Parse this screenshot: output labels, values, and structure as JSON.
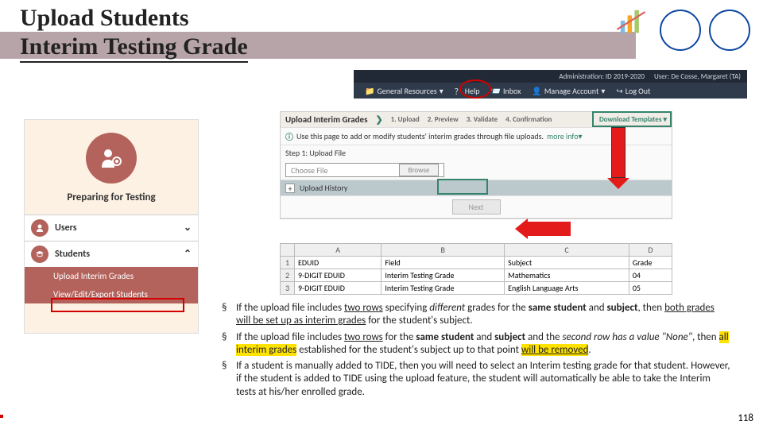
{
  "title_line1": "Upload Students",
  "title_line2": "Interim Testing Grade",
  "topbar": {
    "admin": "Administration: ID 2019-2020",
    "user": "User: De Cosse, Margaret (TA)"
  },
  "nav": {
    "resources": "General Resources",
    "help": "Help",
    "inbox": "Inbox",
    "manage": "Manage Account",
    "logout": "Log Out"
  },
  "sidebar": {
    "heading": "Preparing for Testing",
    "users": "Users",
    "students": "Students",
    "sub1": "Upload Interim Grades",
    "sub2": "View/Edit/Export Students"
  },
  "wizard": {
    "title": "Upload Interim Grades",
    "s1": "1. Upload",
    "s2": "2. Preview",
    "s3": "3. Validate",
    "s4": "4. Confirmation",
    "download": "Download Templates",
    "info": "Use this page to add or modify students' interim grades through file uploads.",
    "more": "more info",
    "step_label": "Step 1: Upload File",
    "choose": "Choose File",
    "browse": "Browse",
    "history": "Upload History",
    "next": "Next"
  },
  "sheet": {
    "cols": [
      "A",
      "B",
      "C",
      "D"
    ],
    "row1": [
      "EDUID",
      "Field",
      "Subject",
      "Grade"
    ],
    "row2": [
      "9-DIGIT EDUID",
      "Interim Testing Grade",
      "Mathematics",
      "04"
    ],
    "row3": [
      "9-DIGIT EDUID",
      "Interim Testing Grade",
      "English Language Arts",
      "05"
    ]
  },
  "bullets": {
    "b1a": "If the upload file includes ",
    "b1b": "two rows",
    "b1c": " specifying ",
    "b1d": "different",
    "b1e": " grades for the ",
    "b1f": "same student",
    "b1g": " and ",
    "b1h": "subject",
    "b1i": ", then ",
    "b1j": "both grades will be set up as interim grades",
    "b1k": " for the student's subject.",
    "b2a": "If the upload file includes ",
    "b2b": "two rows",
    "b2c": " for the ",
    "b2d": "same student",
    "b2e": " and ",
    "b2f": "subject",
    "b2g": " and the ",
    "b2h": "second row has a value \"None\"",
    "b2i": ", then ",
    "b2j": "all interim grades",
    "b2k": " established for the student's subject up to that point ",
    "b2l": "will be removed",
    "b2m": ".",
    "b3": "If a student is manually added to TIDE, then you will need to select an Interim testing grade for that student. However, if the student is added to TIDE using the upload feature, the student will automatically be able to take the Interim tests at his/her enrolled grade."
  },
  "page": "118"
}
